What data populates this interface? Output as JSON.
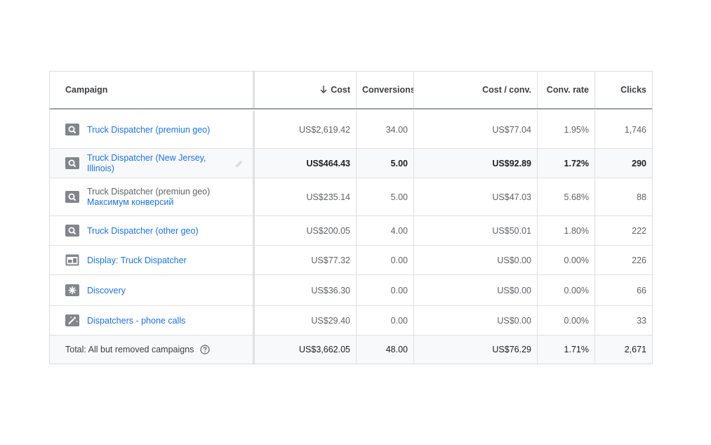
{
  "columns": {
    "campaign": "Campaign",
    "cost": "Cost",
    "conversions": "Conversions",
    "cost_per_conv": "Cost / conv.",
    "conv_rate": "Conv. rate",
    "clicks": "Clicks"
  },
  "rows": [
    {
      "icon": "search-icon",
      "name": "Truck Dispatcher (premiun geo)",
      "cost": "US$2,619.42",
      "conversions": "34.00",
      "cost_per_conv": "US$77.04",
      "conv_rate": "1.95%",
      "clicks": "1,746"
    },
    {
      "icon": "search-icon",
      "name": "Truck Dispatcher (New Jersey,",
      "name2": "Illinois)",
      "cost": "US$464.43",
      "conversions": "5.00",
      "cost_per_conv": "US$92.89",
      "conv_rate": "1.72%",
      "clicks": "290"
    },
    {
      "icon": "search-icon",
      "name": "Truck Dispatcher (premiun geo)",
      "sub": "Максимум конверсий",
      "cost": "US$235.14",
      "conversions": "5.00",
      "cost_per_conv": "US$47.03",
      "conv_rate": "5.68%",
      "clicks": "88"
    },
    {
      "icon": "search-icon",
      "name": "Truck Dispatcher (other geo)",
      "cost": "US$200.05",
      "conversions": "4.00",
      "cost_per_conv": "US$50.01",
      "conv_rate": "1.80%",
      "clicks": "222"
    },
    {
      "icon": "display-icon",
      "name": "Display: Truck Dispatcher",
      "cost": "US$77.32",
      "conversions": "0.00",
      "cost_per_conv": "US$0.00",
      "conv_rate": "0.00%",
      "clicks": "226"
    },
    {
      "icon": "discovery-icon",
      "name": "Discovery",
      "cost": "US$36.30",
      "conversions": "0.00",
      "cost_per_conv": "US$0.00",
      "conv_rate": "0.00%",
      "clicks": "66"
    },
    {
      "icon": "smart-icon",
      "name": "Dispatchers - phone calls",
      "cost": "US$29.40",
      "conversions": "0.00",
      "cost_per_conv": "US$0.00",
      "conv_rate": "0.00%",
      "clicks": "33"
    }
  ],
  "total": {
    "label": "Total: All but removed campaigns",
    "cost": "US$3,662.05",
    "conversions": "48.00",
    "cost_per_conv": "US$76.29",
    "conv_rate": "1.71%",
    "clicks": "2,671"
  }
}
